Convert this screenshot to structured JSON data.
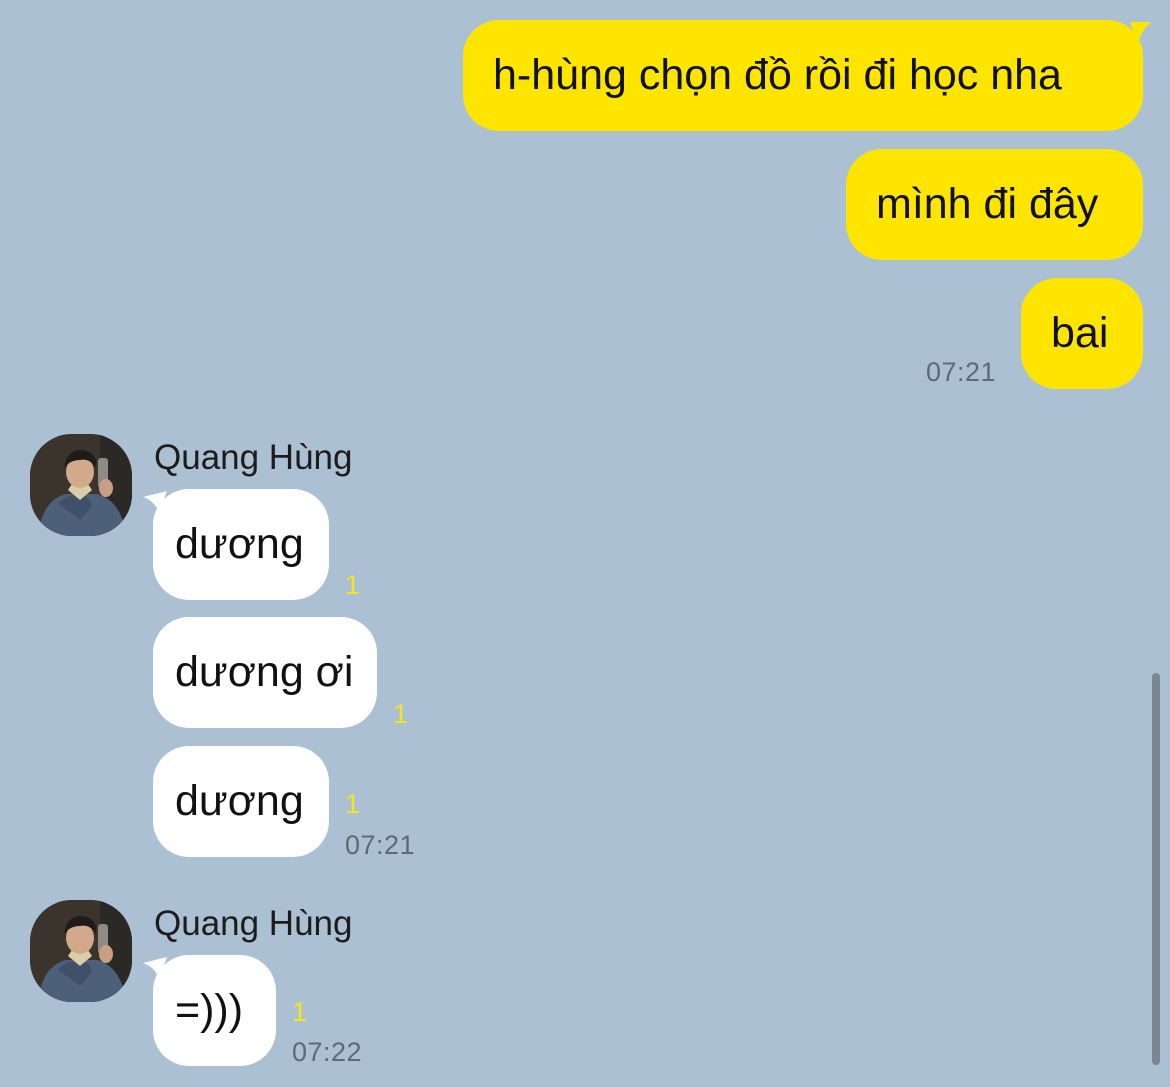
{
  "sent_messages": [
    {
      "text": "h-hùng chọn đồ rồi đi học nha"
    },
    {
      "text": "mình đi đây"
    },
    {
      "text": "bai"
    }
  ],
  "sent_time": "07:21",
  "groups": [
    {
      "sender": "Quang Hùng",
      "messages": [
        {
          "text": "dương",
          "unread": "1"
        },
        {
          "text": "dương ơi",
          "unread": "1"
        },
        {
          "text": "dương",
          "unread": "1"
        }
      ],
      "time": "07:21"
    },
    {
      "sender": "Quang Hùng",
      "messages": [
        {
          "text": "=)))",
          "unread": "1"
        }
      ],
      "time": "07:22"
    }
  ],
  "colors": {
    "background": "#abc1d3",
    "outgoing_bubble": "#fee500",
    "incoming_bubble": "#ffffff",
    "unread_count": "#f6e51a",
    "timestamp": "#5c6a77"
  },
  "icons": {
    "avatar": "profile-photo"
  }
}
